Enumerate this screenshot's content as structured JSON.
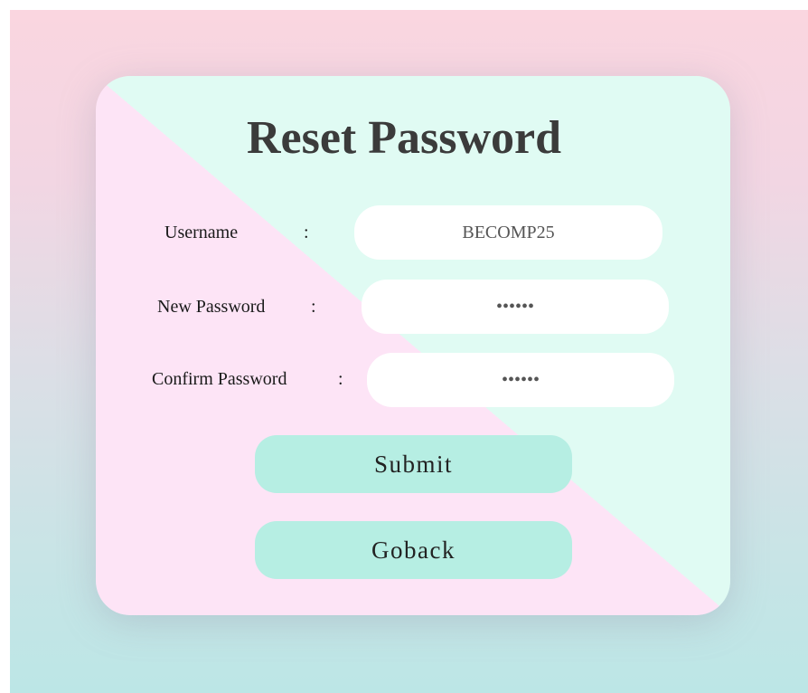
{
  "form": {
    "title": "Reset Password",
    "colon": ":",
    "username": {
      "label": "Username",
      "value": "BECOMP25"
    },
    "new_password": {
      "label": "New Password",
      "value": "••••••"
    },
    "confirm_password": {
      "label": "Confirm Password",
      "value": "••••••"
    },
    "submit_label": "Submit",
    "goback_label": "Goback"
  },
  "colors": {
    "button": "#b6eee3",
    "card_light_mint": "#e0fbf3",
    "card_light_pink": "#fde4f6",
    "title_text": "#3b3b3b"
  }
}
